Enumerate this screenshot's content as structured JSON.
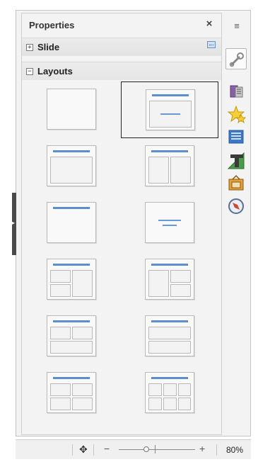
{
  "panel": {
    "title": "Properties",
    "close_label": "×"
  },
  "sections": {
    "slide": {
      "label": "Slide",
      "expander": "+"
    },
    "layouts": {
      "label": "Layouts",
      "expander": "−"
    }
  },
  "layouts": [
    {
      "name": "blank-slide",
      "selected": false
    },
    {
      "name": "title-content",
      "selected": true
    },
    {
      "name": "title-and-content",
      "selected": false
    },
    {
      "name": "title-two-content",
      "selected": false
    },
    {
      "name": "title-only",
      "selected": false
    },
    {
      "name": "centered-text",
      "selected": false
    },
    {
      "name": "title-2-content-and-content",
      "selected": false
    },
    {
      "name": "title-content-and-2-content",
      "selected": false
    },
    {
      "name": "title-2-content-over-content",
      "selected": false
    },
    {
      "name": "title-content-over-content",
      "selected": false
    },
    {
      "name": "title-4-content",
      "selected": false
    },
    {
      "name": "title-6-content",
      "selected": false
    }
  ],
  "deck": {
    "menu_glyph": "≡",
    "buttons": [
      "properties-icon",
      "slide-transition-icon",
      "animation-icon",
      "master-slides-icon",
      "styles-icon",
      "gallery-icon",
      "navigator-icon"
    ]
  },
  "statusbar": {
    "move_glyph": "✥",
    "zoom_minus": "−",
    "zoom_plus": "+",
    "zoom_level": "80%"
  },
  "colors": {
    "accent": "#5b8ecb",
    "panel_bg": "#f3f3f3"
  }
}
